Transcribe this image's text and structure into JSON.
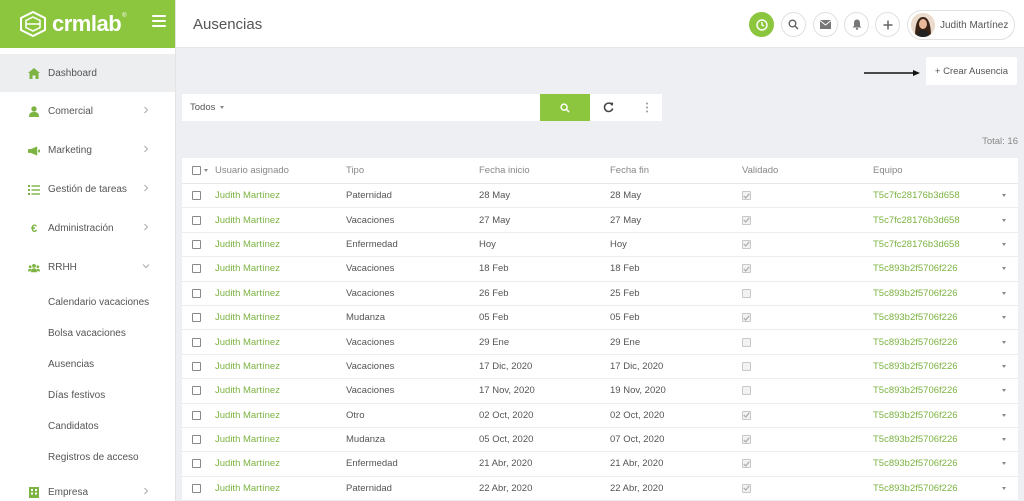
{
  "app": {
    "logo_text": "crmlab",
    "logo_tm": "®"
  },
  "sidebar": {
    "items": [
      {
        "label": "Dashboard",
        "icon": "home-icon"
      },
      {
        "label": "Comercial",
        "icon": "user-icon"
      },
      {
        "label": "Marketing",
        "icon": "megaphone-icon"
      },
      {
        "label": "Gestión de tareas",
        "icon": "list-icon"
      },
      {
        "label": "Administración",
        "icon": "euro-icon"
      },
      {
        "label": "RRHH",
        "icon": "users-icon"
      },
      {
        "label": "Empresa",
        "icon": "building-icon"
      }
    ],
    "rrhh_sub": [
      "Calendario vacaciones",
      "Bolsa vacaciones",
      "Ausencias",
      "Días festivos",
      "Candidatos",
      "Registros de acceso"
    ]
  },
  "header": {
    "title": "Ausencias",
    "user_name": "Judith Martínez"
  },
  "toolbar": {
    "create_label": "+ Crear Ausencia",
    "filter_label": "Todos",
    "total_label": "Total: 16"
  },
  "colors": {
    "accent": "#8cc63f",
    "link": "#7cb342"
  },
  "table": {
    "headers": [
      "Usuario asignado",
      "Tipo",
      "Fecha inicio",
      "Fecha fin",
      "Validado",
      "Equipo"
    ],
    "rows": [
      {
        "user": "Judith Martínez",
        "tipo": "Paternidad",
        "inicio": "28 May",
        "fin": "28 May",
        "validado": true,
        "equipo": "T5c7fc28176b3d658"
      },
      {
        "user": "Judith Martínez",
        "tipo": "Vacaciones",
        "inicio": "27 May",
        "fin": "27 May",
        "validado": true,
        "equipo": "T5c7fc28176b3d658"
      },
      {
        "user": "Judith Martínez",
        "tipo": "Enfermedad",
        "inicio": "Hoy",
        "fin": "Hoy",
        "validado": true,
        "equipo": "T5c7fc28176b3d658"
      },
      {
        "user": "Judith Martínez",
        "tipo": "Vacaciones",
        "inicio": "18 Feb",
        "fin": "18 Feb",
        "validado": true,
        "equipo": "T5c893b2f5706f226"
      },
      {
        "user": "Judith Martínez",
        "tipo": "Vacaciones",
        "inicio": "26 Feb",
        "fin": "25 Feb",
        "validado": false,
        "equipo": "T5c893b2f5706f226"
      },
      {
        "user": "Judith Martínez",
        "tipo": "Mudanza",
        "inicio": "05 Feb",
        "fin": "05 Feb",
        "validado": true,
        "equipo": "T5c893b2f5706f226"
      },
      {
        "user": "Judith Martínez",
        "tipo": "Vacaciones",
        "inicio": "29 Ene",
        "fin": "29 Ene",
        "validado": false,
        "equipo": "T5c893b2f5706f226"
      },
      {
        "user": "Judith Martínez",
        "tipo": "Vacaciones",
        "inicio": "17 Dic, 2020",
        "fin": "17 Dic, 2020",
        "validado": false,
        "equipo": "T5c893b2f5706f226"
      },
      {
        "user": "Judith Martínez",
        "tipo": "Vacaciones",
        "inicio": "17 Nov, 2020",
        "fin": "19 Nov, 2020",
        "validado": false,
        "equipo": "T5c893b2f5706f226"
      },
      {
        "user": "Judith Martínez",
        "tipo": "Otro",
        "inicio": "02 Oct, 2020",
        "fin": "02 Oct, 2020",
        "validado": true,
        "equipo": "T5c893b2f5706f226"
      },
      {
        "user": "Judith Martínez",
        "tipo": "Mudanza",
        "inicio": "05 Oct, 2020",
        "fin": "07 Oct, 2020",
        "validado": true,
        "equipo": "T5c893b2f5706f226"
      },
      {
        "user": "Judith Martínez",
        "tipo": "Enfermedad",
        "inicio": "21 Abr, 2020",
        "fin": "21 Abr, 2020",
        "validado": true,
        "equipo": "T5c893b2f5706f226"
      },
      {
        "user": "Judith Martínez",
        "tipo": "Paternidad",
        "inicio": "22 Abr, 2020",
        "fin": "22 Abr, 2020",
        "validado": true,
        "equipo": "T5c893b2f5706f226"
      }
    ]
  }
}
